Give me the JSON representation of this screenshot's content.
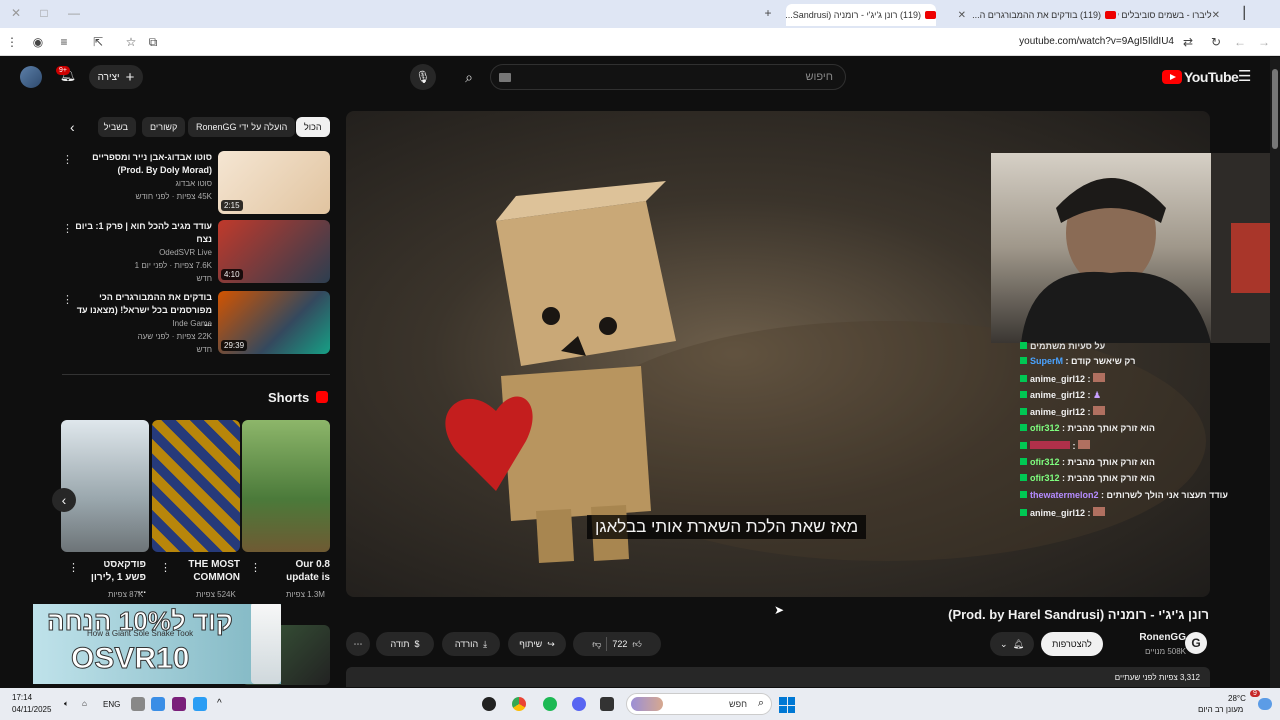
{
  "browser": {
    "tabs": [
      {
        "label": "ליברו - בשמים סוביבלים לגבר ול...",
        "active": false
      },
      {
        "label": "(119) בודקים את ההמבורגרים ה...",
        "active": false
      },
      {
        "label": "(119) רונן ג'יג'י - רומניה (Sandrusi...",
        "active": true
      }
    ],
    "url": "youtube.com/watch?v=9AgI5IldIU4"
  },
  "header": {
    "search_placeholder": "חיפוש",
    "create_label": "יצירה",
    "notif_count": "9+",
    "logo_text": "YouTube"
  },
  "chips": [
    {
      "label": "הכול",
      "selected": true
    },
    {
      "label": "הועלה על ידי RonenGG",
      "selected": false
    },
    {
      "label": "קשורים",
      "selected": false
    },
    {
      "label": "בשביל",
      "selected": false
    }
  ],
  "related": [
    {
      "title": "סוטו אבדוג-אבן נייר ומספריים (Prod. By Doly Morad)",
      "channel": "סוטו אבדוג",
      "meta": "45K צפיות · לפני חודש",
      "meta2": "",
      "duration": "2:15"
    },
    {
      "title": "עודד מגיב להכל חוא | פרק 1: ביום נצח",
      "channel": "OdedSVR Live",
      "meta": "7.6K צפיות · לפני יום 1",
      "meta2": "חדש",
      "duration": "4:10"
    },
    {
      "title": "בודקים את ההמבורגרים הכי מפורסמים בכל ישראל! (מצאנו עד ...",
      "channel": "Inde Game",
      "meta": "22K צפיות · לפני שעה",
      "meta2": "חדש",
      "duration": "29:39"
    }
  ],
  "shorts": {
    "heading": "Shorts",
    "items": [
      {
        "title": "פודקאסט פשע 1 ,לירון ...",
        "views": "87K צפיות"
      },
      {
        "title": "THE MOST COMMON",
        "views": "524K צפיות"
      },
      {
        "title": "Our 0.8 update is",
        "views": "1.3M צפיות"
      }
    ]
  },
  "ad": {
    "line1": "קוד ל10% הנחה",
    "code": "OSVR10",
    "small": "How a Giant Sole Snake Took"
  },
  "player": {
    "subtitle": "מאז שאת הלכת השארת אותי בבלאגן",
    "chat": [
      {
        "user": "",
        "msg": "על סעיות משתמים"
      },
      {
        "user": "SuperM",
        "msg": "רק שיאשר קודם"
      },
      {
        "user": "anime_girl12",
        "msg": ""
      },
      {
        "user": "anime_girl12",
        "msg": ""
      },
      {
        "user": "anime_girl12",
        "msg": ""
      },
      {
        "user": "ofir312",
        "msg": "הוא זורק אותך מהבית"
      },
      {
        "user": "",
        "msg": ""
      },
      {
        "user": "ofir312",
        "msg": "הוא זורק אותך מהבית"
      },
      {
        "user": "ofir312",
        "msg": "הוא זורק אותך מהבית"
      },
      {
        "user": "thewatermelon2",
        "msg": "עודד תעצור אני הולך לשרותים"
      },
      {
        "user": "anime_girl12",
        "msg": ""
      }
    ]
  },
  "video": {
    "title": "רונן ג'יג'י - רומניה (Prod. by Harel Sandrusi)",
    "channel": "RonenGG",
    "subs": "508K מנויים",
    "subscribe_label": "להצטרפות",
    "likes": "722",
    "share_label": "שיתוף",
    "download_label": "הורדה",
    "thanks_label": "תודה",
    "views_line": "3,312 צפיות  לפני שעתיים"
  },
  "taskbar": {
    "time": "17:14",
    "date": "04/11/2025",
    "lang": "ENG",
    "search_label": "חפש",
    "weather_temp": "28°C",
    "weather_desc": "מעונן רב היום",
    "weather_badge": "9"
  }
}
